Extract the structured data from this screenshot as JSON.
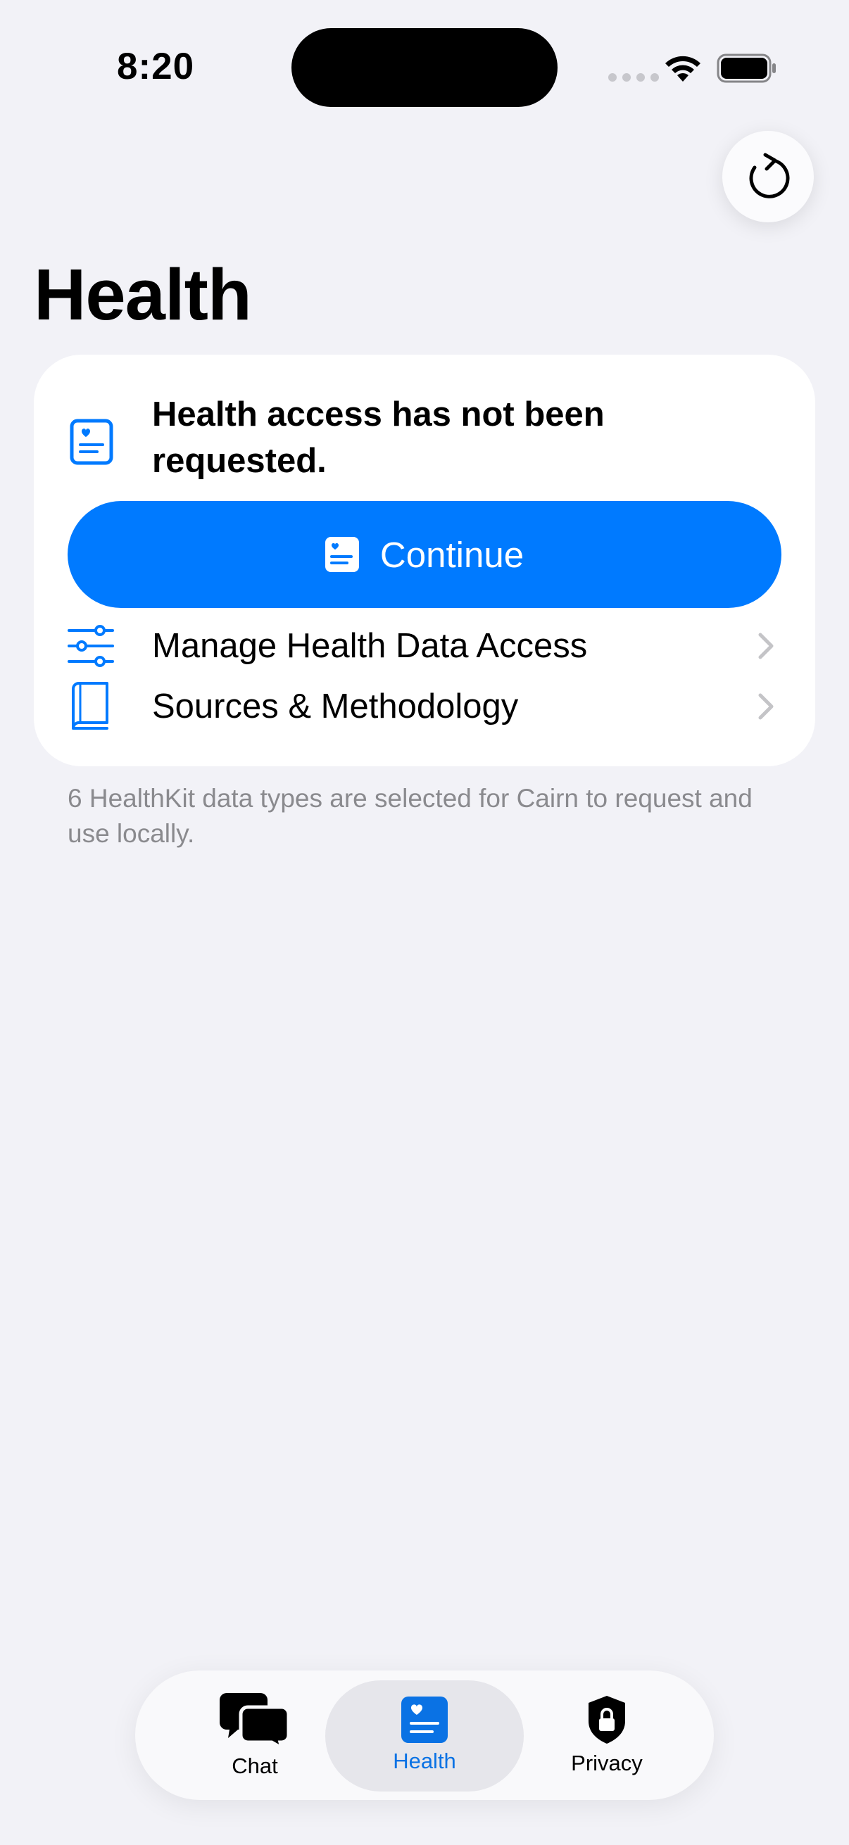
{
  "status_bar": {
    "time": "8:20"
  },
  "header": {
    "title": "Health"
  },
  "card": {
    "message": "Health access has not been requested.",
    "continue_label": "Continue",
    "rows": [
      {
        "label": "Manage Health Data Access",
        "icon": "sliders-icon"
      },
      {
        "label": "Sources & Methodology",
        "icon": "book-icon"
      }
    ]
  },
  "footnote": "6 HealthKit data types are selected for Cairn to request and use locally.",
  "tab_bar": {
    "tabs": [
      {
        "label": "Chat",
        "icon": "chat-bubbles-icon",
        "selected": false
      },
      {
        "label": "Health",
        "icon": "health-record-icon",
        "selected": true
      },
      {
        "label": "Privacy",
        "icon": "lock-shield-icon",
        "selected": false
      }
    ]
  },
  "colors": {
    "accent": "#007aff",
    "background": "#f2f2f7",
    "secondary_text": "#8a8a8e"
  }
}
